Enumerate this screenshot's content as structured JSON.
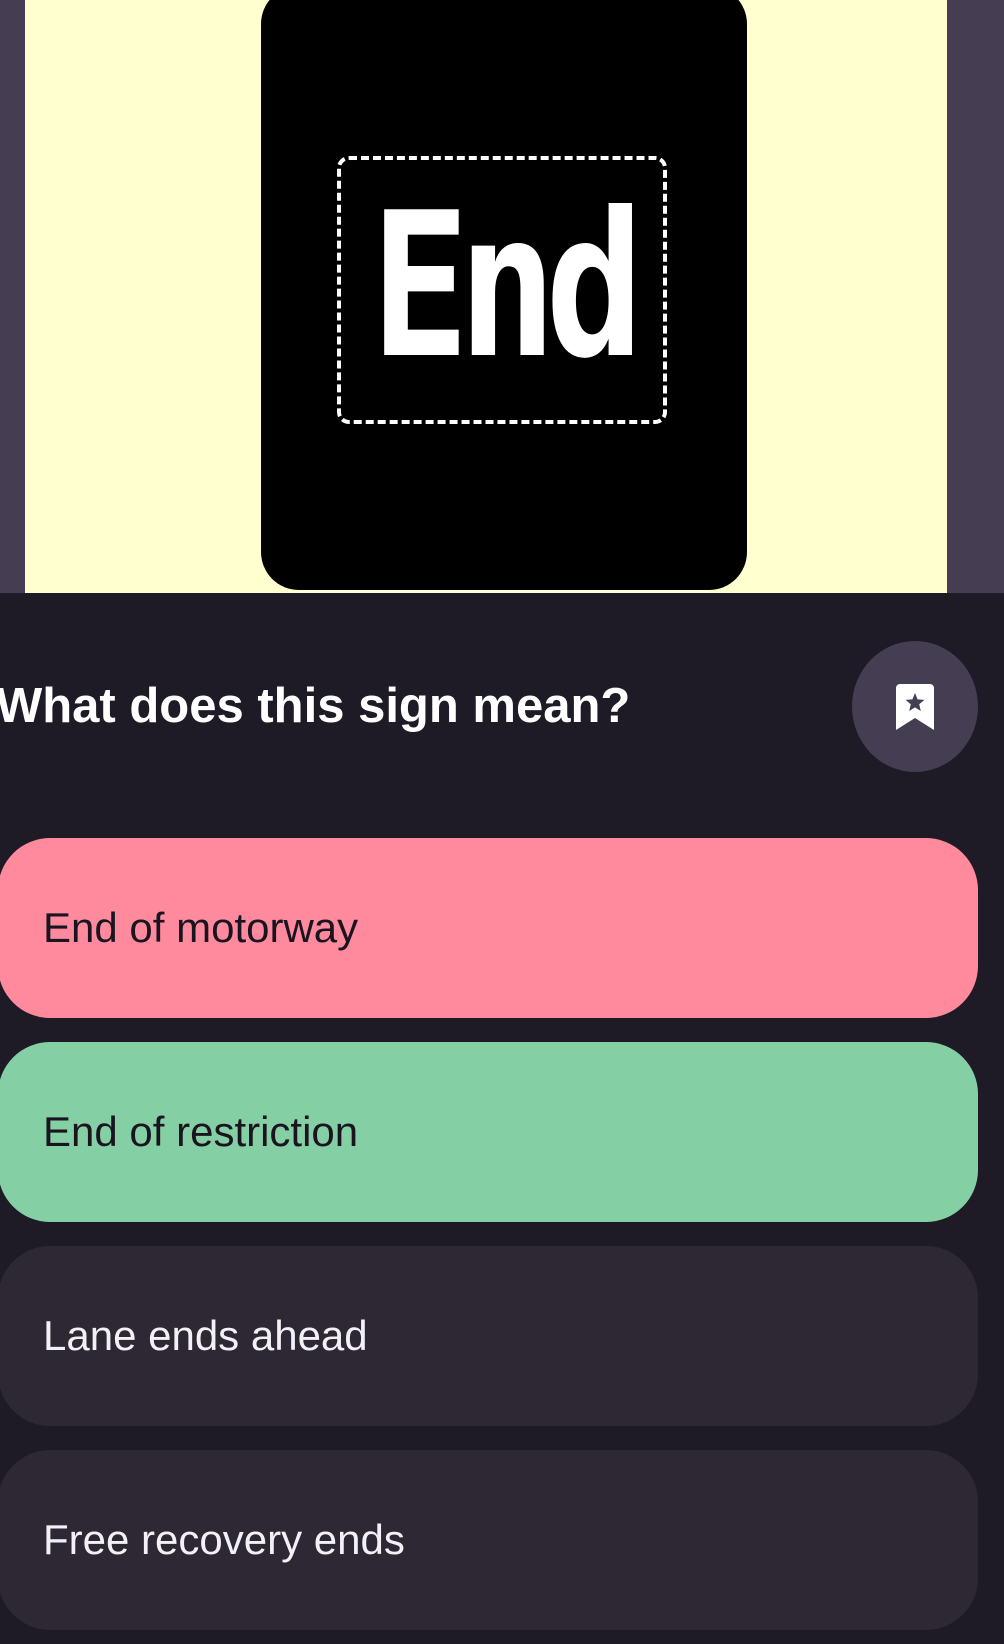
{
  "sign": {
    "text": "End",
    "background_color": "#000000",
    "panel_color": "#ffffd0"
  },
  "question": {
    "text": "What does this sign mean?"
  },
  "bookmark": {
    "icon": "bookmark-star-icon"
  },
  "answers": [
    {
      "label": "End of motorway",
      "state": "incorrect",
      "color": "#ff8a9e"
    },
    {
      "label": "End of restriction",
      "state": "correct",
      "color": "#84d0a4"
    },
    {
      "label": "Lane ends ahead",
      "state": "unselected",
      "color": "#2d2834"
    },
    {
      "label": "Free recovery ends",
      "state": "unselected",
      "color": "#2d2834"
    }
  ]
}
